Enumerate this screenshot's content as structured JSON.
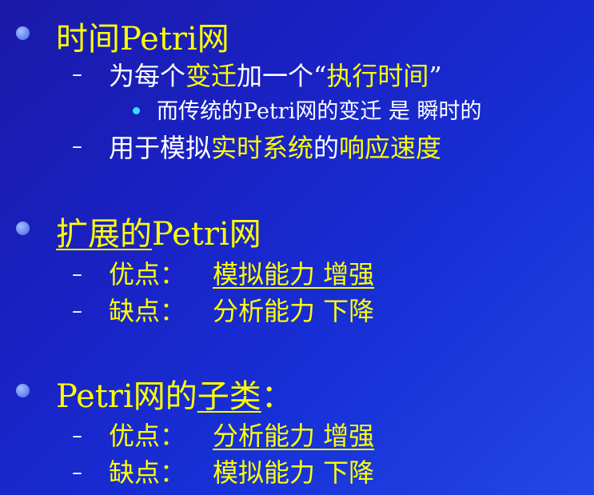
{
  "section1": {
    "heading": "时间Petri网",
    "item1": {
      "part1": "为每个",
      "part2": "变迁",
      "part3": "加一个“",
      "part4": "执行时间",
      "part5": "”"
    },
    "sub1": "而传统的Petri网的变迁 是 瞬时的",
    "item2": {
      "part1": "用于模拟",
      "part2": "实时系统",
      "part3": "的",
      "part4": "响应速度"
    }
  },
  "section2": {
    "heading_underlined": "扩展的",
    "heading_rest": "Petri网",
    "pro_label": "优点：",
    "pro_value": "模拟能力 增强",
    "con_label": "缺点：",
    "con_value": "分析能力 下降"
  },
  "section3": {
    "heading_part1": "Petri网的",
    "heading_underlined": "子类",
    "heading_colon": "：",
    "pro_label": "优点：",
    "pro_value": "分析能力 增强",
    "con_label": "缺点：",
    "con_value": "模拟能力 下降"
  }
}
